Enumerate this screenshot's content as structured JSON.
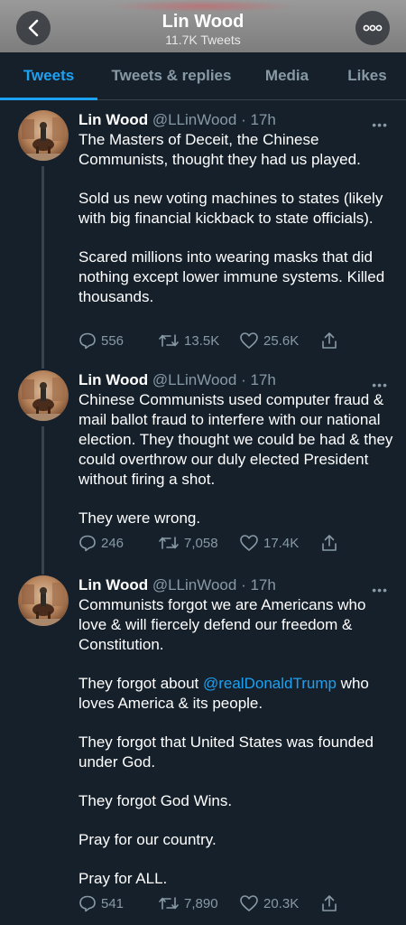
{
  "header": {
    "title": "Lin Wood",
    "subtitle": "11.7K Tweets"
  },
  "tabs": [
    {
      "label": "Tweets",
      "active": true
    },
    {
      "label": "Tweets & replies"
    },
    {
      "label": "Media"
    },
    {
      "label": "Likes"
    }
  ],
  "colors": {
    "accent": "#1da1f2",
    "background": "#15202b",
    "muted": "#8899a6"
  },
  "tweets": [
    {
      "name": "Lin Wood",
      "handle_time": "@LLinWood · 17h",
      "paragraphs": [
        "The Masters of Deceit, the Chinese Communists, thought they had us played.",
        "Sold us new voting machines to states (likely with big financial kickback to state officials).",
        "Scared millions into wearing masks that did nothing except lower immune systems. Killed thousands."
      ],
      "replies": "556",
      "retweets": "13.5K",
      "likes": "25.6K"
    },
    {
      "name": "Lin Wood",
      "handle_time": "@LLinWood · 17h",
      "paragraphs": [
        "Chinese Communists used computer fraud & mail ballot fraud to interfere with our national election. They thought we could be had & they could overthrow our duly elected President without firing a shot.",
        "They were wrong."
      ],
      "replies": "246",
      "retweets": "7,058",
      "likes": "17.4K"
    },
    {
      "name": "Lin Wood",
      "handle_time": "@LLinWood · 17h",
      "paragraphs": [
        "Communists forgot we are Americans who love & will fiercely defend our freedom & Constitution.",
        "They forgot about ",
        "They forgot that United States was founded under God.",
        "They forgot God Wins.",
        "Pray for our country.",
        "Pray for ALL."
      ],
      "mention": "@realDonaldTrump",
      "mention_after": " who loves America & its people.",
      "replies": "541",
      "retweets": "7,890",
      "likes": "20.3K"
    }
  ]
}
